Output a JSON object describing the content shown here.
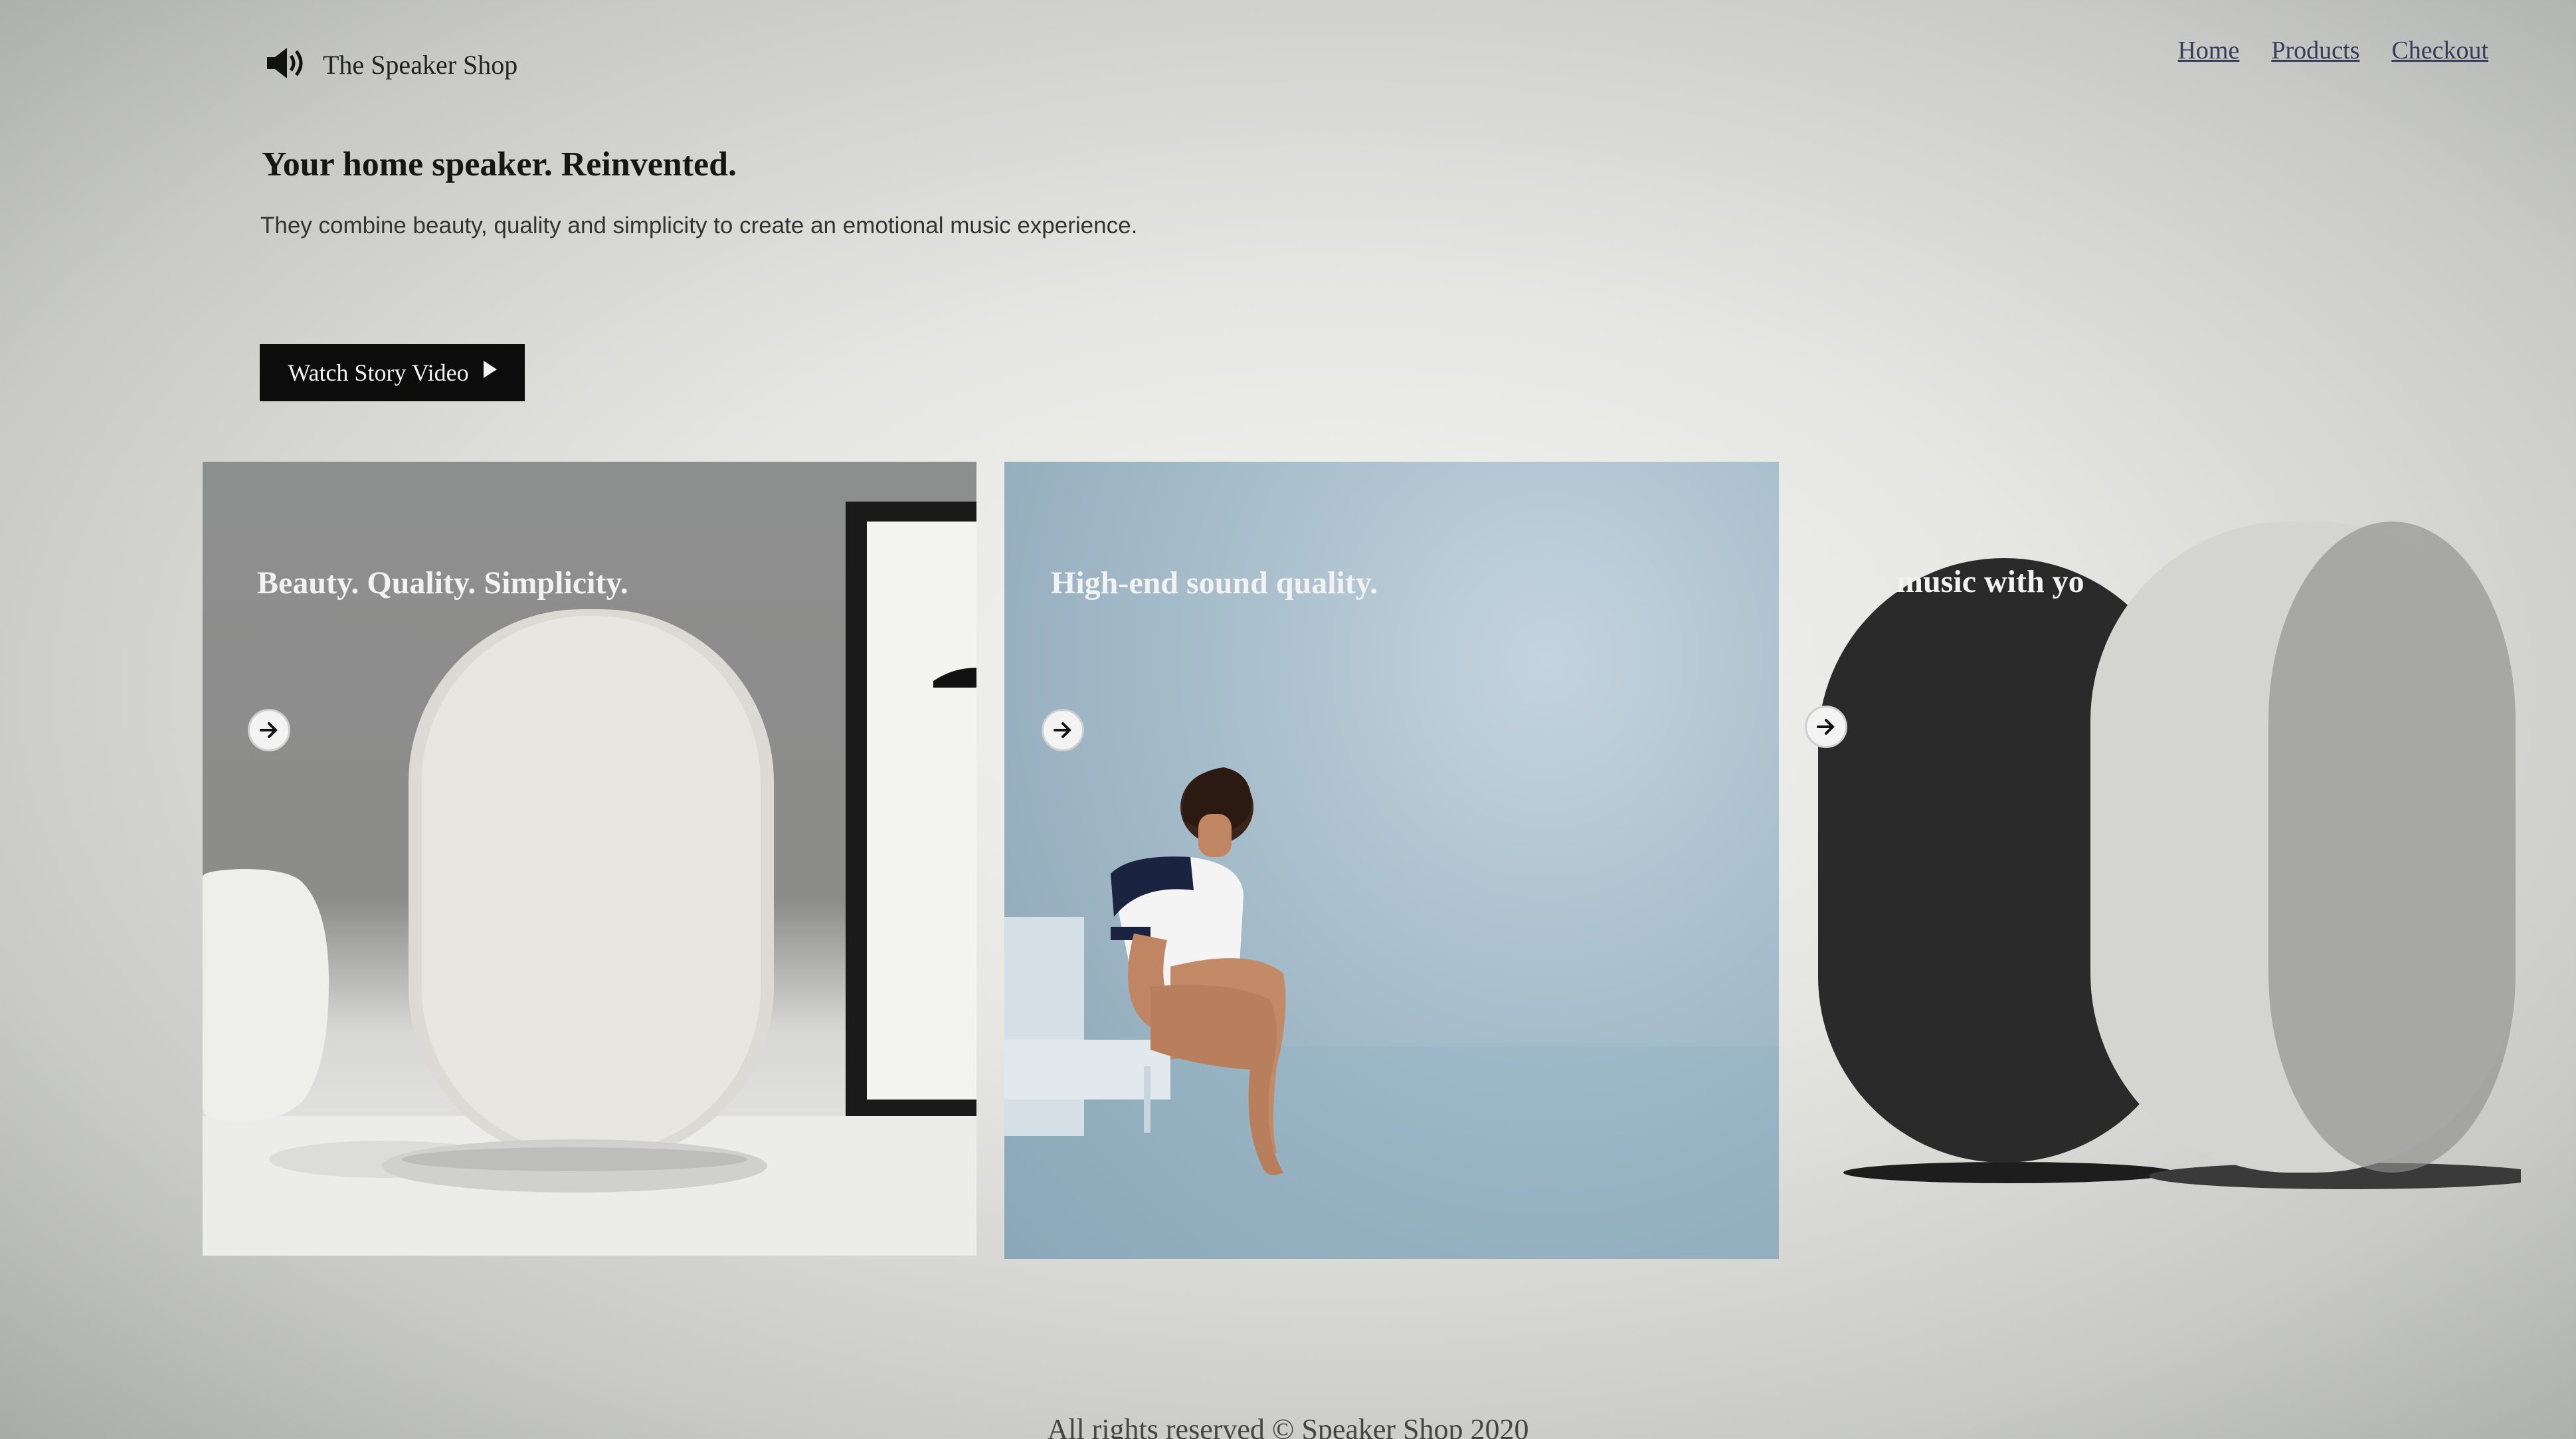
{
  "header": {
    "logo_icon": "speaker-icon",
    "logo_text": "The Speaker Shop",
    "nav": [
      {
        "label": "Home"
      },
      {
        "label": "Products"
      },
      {
        "label": "Checkout"
      }
    ]
  },
  "hero": {
    "title": "Your home speaker. Reinvented.",
    "subtitle": "They combine beauty, quality and simplicity to create an emotional music experience.",
    "cta_label": "Watch Story Video",
    "cta_icon": "play-icon"
  },
  "cards": [
    {
      "title": "Beauty. Quality. Simplicity.",
      "arrow_icon": "arrow-right-icon"
    },
    {
      "title": "High-end sound quality.",
      "arrow_icon": "arrow-right-icon"
    },
    {
      "title": "music with yo",
      "arrow_icon": "arrow-right-icon"
    }
  ],
  "footer": {
    "text": "All rights reserved © Speaker Shop 2020"
  },
  "colors": {
    "button_bg": "#0c0c0c",
    "nav_link": "#3a3a5a",
    "card2_bg": "#a9bfcc"
  }
}
